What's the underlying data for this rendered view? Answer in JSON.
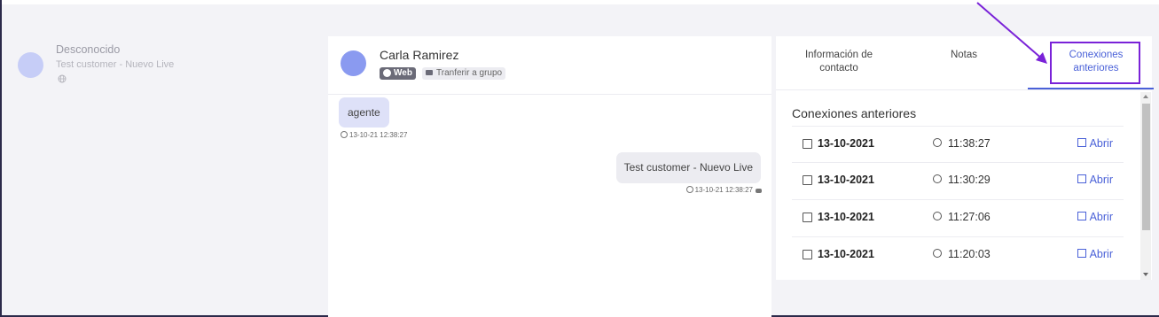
{
  "conversation": {
    "name": "Desconocido",
    "subtitle": "Test customer - Nuevo Live",
    "channel_icon": "globe-icon"
  },
  "chat": {
    "contact_name": "Carla Ramirez",
    "badge_web": "Web",
    "transfer_label": "Tranferir a grupo",
    "messages": [
      {
        "text": "agente",
        "time": "13-10-21 12:38:27",
        "direction": "incoming"
      },
      {
        "text": "Test customer - Nuevo Live",
        "time": "13-10-21 12:38:27",
        "direction": "outgoing"
      }
    ]
  },
  "panel": {
    "tabs": [
      {
        "label": "Información de contacto"
      },
      {
        "label": "Notas"
      },
      {
        "label": "Conexiones anteriores"
      }
    ],
    "active_tab": "Conexiones anteriores",
    "section_title": "Conexiones anteriores",
    "open_label": "Abrir",
    "rows": [
      {
        "date": "13-10-2021",
        "time": "11:38:27"
      },
      {
        "date": "13-10-2021",
        "time": "11:30:29"
      },
      {
        "date": "13-10-2021",
        "time": "11:27:06"
      },
      {
        "date": "13-10-2021",
        "time": "11:20:03"
      }
    ]
  },
  "colors": {
    "accent": "#4a61d8",
    "annotation": "#7a22d8"
  }
}
